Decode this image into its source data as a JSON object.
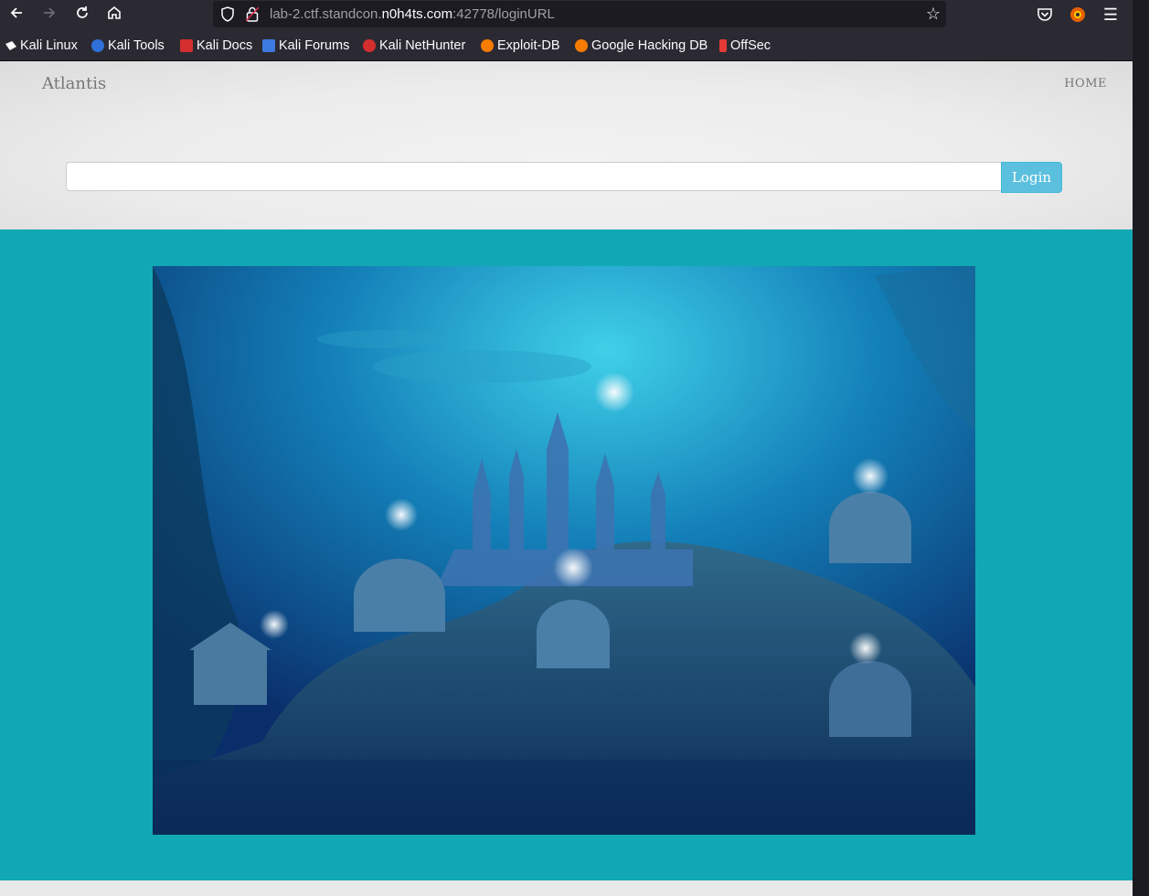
{
  "browser": {
    "url_host_prefix": "lab-2.ctf.standcon.",
    "url_domain": "n0h4ts.com",
    "url_path": ":42778/loginURL",
    "nav": {
      "back_icon": "arrow-left-icon",
      "forward_icon": "arrow-right-icon",
      "reload_icon": "reload-icon",
      "home_icon": "home-icon"
    }
  },
  "bookmarks": [
    {
      "label": "Kali Linux",
      "color": "#ffffff"
    },
    {
      "label": "Kali Tools",
      "color": "#2f6fd8"
    },
    {
      "label": "Kali Docs",
      "color": "#d32f2f"
    },
    {
      "label": "Kali Forums",
      "color": "#3d7be0"
    },
    {
      "label": "Kali NetHunter",
      "color": "#d32f2f"
    },
    {
      "label": "Exploit-DB",
      "color": "#f57c00"
    },
    {
      "label": "Google Hacking DB",
      "color": "#f57c00"
    },
    {
      "label": "OffSec",
      "color": "#e53935"
    }
  ],
  "site": {
    "brand": "Atlantis",
    "nav_home": "HOME",
    "url_input_value": "",
    "url_input_placeholder": "",
    "login_label": "Login",
    "accent": "#5bc0de",
    "band_color": "#12a8b3"
  },
  "hero_image": {
    "icon": "underwater-city-image"
  }
}
